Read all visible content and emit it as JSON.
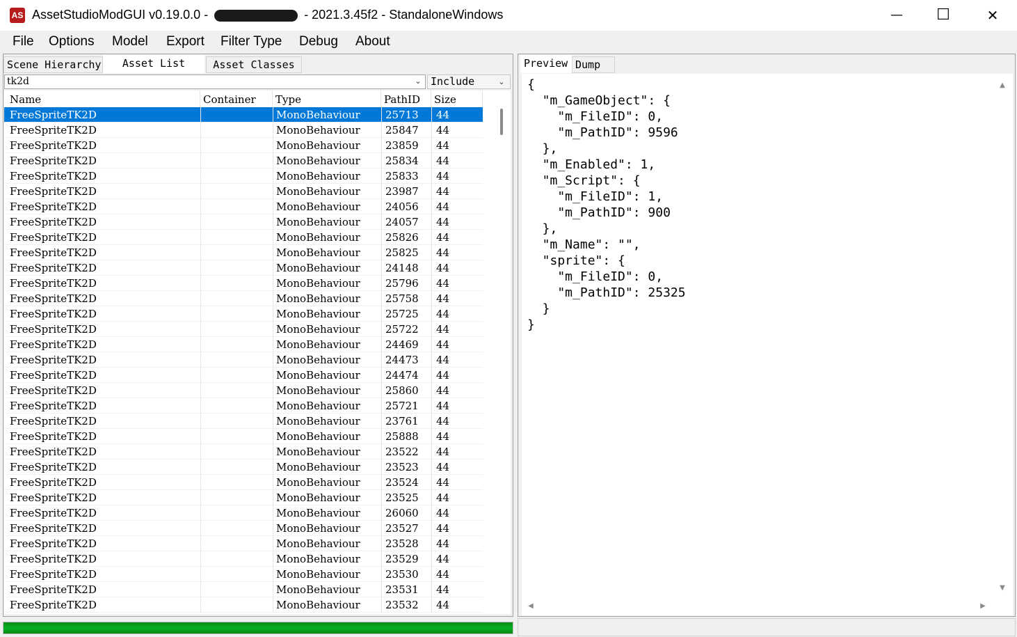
{
  "window": {
    "title_prefix": "AssetStudioModGUI v0.19.0.0 -",
    "title_suffix": "- 2021.3.45f2 - StandaloneWindows",
    "icon_text": "AS",
    "minimize": "—",
    "maximize": "☐",
    "close": "✕"
  },
  "menu": [
    "File",
    "Options",
    "Model",
    "Export",
    "Filter Type",
    "Debug",
    "About"
  ],
  "left_tabs": [
    "Scene Hierarchy",
    "Asset List",
    "Asset Classes"
  ],
  "filter": {
    "value": "tk2d",
    "mode": "Include",
    "chevron": "⌄"
  },
  "columns": [
    "Name",
    "Container",
    "Type",
    "PathID",
    "Size"
  ],
  "rows": [
    {
      "name": "FreeSpriteTK2D",
      "container": "",
      "type": "MonoBehaviour",
      "path_id": "25713",
      "size": "44"
    },
    {
      "name": "FreeSpriteTK2D",
      "container": "",
      "type": "MonoBehaviour",
      "path_id": "25847",
      "size": "44"
    },
    {
      "name": "FreeSpriteTK2D",
      "container": "",
      "type": "MonoBehaviour",
      "path_id": "23859",
      "size": "44"
    },
    {
      "name": "FreeSpriteTK2D",
      "container": "",
      "type": "MonoBehaviour",
      "path_id": "25834",
      "size": "44"
    },
    {
      "name": "FreeSpriteTK2D",
      "container": "",
      "type": "MonoBehaviour",
      "path_id": "25833",
      "size": "44"
    },
    {
      "name": "FreeSpriteTK2D",
      "container": "",
      "type": "MonoBehaviour",
      "path_id": "23987",
      "size": "44"
    },
    {
      "name": "FreeSpriteTK2D",
      "container": "",
      "type": "MonoBehaviour",
      "path_id": "24056",
      "size": "44"
    },
    {
      "name": "FreeSpriteTK2D",
      "container": "",
      "type": "MonoBehaviour",
      "path_id": "24057",
      "size": "44"
    },
    {
      "name": "FreeSpriteTK2D",
      "container": "",
      "type": "MonoBehaviour",
      "path_id": "25826",
      "size": "44"
    },
    {
      "name": "FreeSpriteTK2D",
      "container": "",
      "type": "MonoBehaviour",
      "path_id": "25825",
      "size": "44"
    },
    {
      "name": "FreeSpriteTK2D",
      "container": "",
      "type": "MonoBehaviour",
      "path_id": "24148",
      "size": "44"
    },
    {
      "name": "FreeSpriteTK2D",
      "container": "",
      "type": "MonoBehaviour",
      "path_id": "25796",
      "size": "44"
    },
    {
      "name": "FreeSpriteTK2D",
      "container": "",
      "type": "MonoBehaviour",
      "path_id": "25758",
      "size": "44"
    },
    {
      "name": "FreeSpriteTK2D",
      "container": "",
      "type": "MonoBehaviour",
      "path_id": "25725",
      "size": "44"
    },
    {
      "name": "FreeSpriteTK2D",
      "container": "",
      "type": "MonoBehaviour",
      "path_id": "25722",
      "size": "44"
    },
    {
      "name": "FreeSpriteTK2D",
      "container": "",
      "type": "MonoBehaviour",
      "path_id": "24469",
      "size": "44"
    },
    {
      "name": "FreeSpriteTK2D",
      "container": "",
      "type": "MonoBehaviour",
      "path_id": "24473",
      "size": "44"
    },
    {
      "name": "FreeSpriteTK2D",
      "container": "",
      "type": "MonoBehaviour",
      "path_id": "24474",
      "size": "44"
    },
    {
      "name": "FreeSpriteTK2D",
      "container": "",
      "type": "MonoBehaviour",
      "path_id": "25860",
      "size": "44"
    },
    {
      "name": "FreeSpriteTK2D",
      "container": "",
      "type": "MonoBehaviour",
      "path_id": "25721",
      "size": "44"
    },
    {
      "name": "FreeSpriteTK2D",
      "container": "",
      "type": "MonoBehaviour",
      "path_id": "23761",
      "size": "44"
    },
    {
      "name": "FreeSpriteTK2D",
      "container": "",
      "type": "MonoBehaviour",
      "path_id": "25888",
      "size": "44"
    },
    {
      "name": "FreeSpriteTK2D",
      "container": "",
      "type": "MonoBehaviour",
      "path_id": "23522",
      "size": "44"
    },
    {
      "name": "FreeSpriteTK2D",
      "container": "",
      "type": "MonoBehaviour",
      "path_id": "23523",
      "size": "44"
    },
    {
      "name": "FreeSpriteTK2D",
      "container": "",
      "type": "MonoBehaviour",
      "path_id": "23524",
      "size": "44"
    },
    {
      "name": "FreeSpriteTK2D",
      "container": "",
      "type": "MonoBehaviour",
      "path_id": "23525",
      "size": "44"
    },
    {
      "name": "FreeSpriteTK2D",
      "container": "",
      "type": "MonoBehaviour",
      "path_id": "26060",
      "size": "44"
    },
    {
      "name": "FreeSpriteTK2D",
      "container": "",
      "type": "MonoBehaviour",
      "path_id": "23527",
      "size": "44"
    },
    {
      "name": "FreeSpriteTK2D",
      "container": "",
      "type": "MonoBehaviour",
      "path_id": "23528",
      "size": "44"
    },
    {
      "name": "FreeSpriteTK2D",
      "container": "",
      "type": "MonoBehaviour",
      "path_id": "23529",
      "size": "44"
    },
    {
      "name": "FreeSpriteTK2D",
      "container": "",
      "type": "MonoBehaviour",
      "path_id": "23530",
      "size": "44"
    },
    {
      "name": "FreeSpriteTK2D",
      "container": "",
      "type": "MonoBehaviour",
      "path_id": "23531",
      "size": "44"
    },
    {
      "name": "FreeSpriteTK2D",
      "container": "",
      "type": "MonoBehaviour",
      "path_id": "23532",
      "size": "44"
    }
  ],
  "selected_row": 0,
  "right_tabs": [
    "Preview",
    "Dump"
  ],
  "dump_text": "{\n  \"m_GameObject\": {\n    \"m_FileID\": 0,\n    \"m_PathID\": 9596\n  },\n  \"m_Enabled\": 1,\n  \"m_Script\": {\n    \"m_FileID\": 1,\n    \"m_PathID\": 900\n  },\n  \"m_Name\": \"\",\n  \"sprite\": {\n    \"m_FileID\": 0,\n    \"m_PathID\": 25325\n  }\n}",
  "progress": {
    "fraction": 1.0,
    "color": "#06b025"
  },
  "colors": {
    "selection": "#0078d7",
    "icon": "#b71c1c"
  },
  "scroll_arrows": {
    "up": "▲",
    "down": "▼",
    "left": "◀",
    "right": "▶"
  }
}
